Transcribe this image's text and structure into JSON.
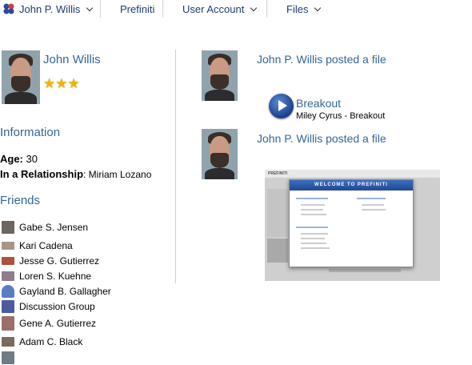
{
  "nav": {
    "user_name": "John P. Willis",
    "items": [
      {
        "label": "Prefiniti"
      },
      {
        "label": "User Account"
      },
      {
        "label": "Files"
      }
    ]
  },
  "profile": {
    "name": "John Willis",
    "rating": 3
  },
  "information": {
    "title": "Information",
    "age_label": "Age:",
    "age_value": "30",
    "relationship_label": "In a Relationship",
    "relationship_value": ": Miriam Lozano"
  },
  "friends": {
    "title": "Friends",
    "items": [
      {
        "name": "Gabe S. Jensen"
      },
      {
        "name": "Kari Cadena"
      },
      {
        "name": "Jesse G. Gutierrez"
      },
      {
        "name": "Loren S. Kuehne"
      },
      {
        "name": "Gayland B. Gallagher"
      },
      {
        "name": "Discussion Group"
      },
      {
        "name": "Gene A. Gutierrez"
      },
      {
        "name": "Adam C. Black"
      }
    ]
  },
  "feed": [
    {
      "headline": "John P. Willis posted a file",
      "media_title": "Breakout",
      "media_subtitle": "Miley Cyrus - Breakout"
    },
    {
      "headline": "John P. Willis posted a file",
      "screenshot_title": "WELCOME TO PREFINITI"
    }
  ],
  "colors": {
    "link": "#336699",
    "star": "#f0b400"
  }
}
